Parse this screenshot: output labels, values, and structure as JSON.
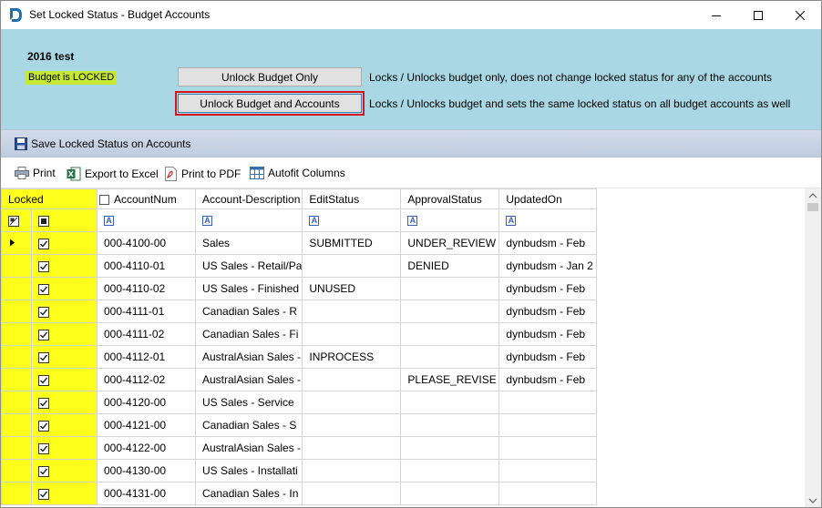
{
  "window": {
    "title": "Set Locked Status - Budget Accounts"
  },
  "panel": {
    "budget_name": "2016 test",
    "status_badge": "Budget is LOCKED",
    "status_color": "#c6e833",
    "unlock_budget_only": "Unlock Budget Only",
    "unlock_budget_only_desc": "Locks / Unlocks budget only, does not change locked status for any of the accounts",
    "unlock_budget_accounts": "Unlock Budget and Accounts",
    "unlock_budget_accounts_desc": "Locks / Unlocks budget and sets the same locked status on all budget accounts as well",
    "highlight_color": "#d9141a"
  },
  "save_band": {
    "label": "Save Locked Status on Accounts"
  },
  "toolbar": {
    "print": "Print",
    "export_excel": "Export to Excel",
    "print_pdf": "Print to PDF",
    "autofit": "Autofit Columns"
  },
  "grid": {
    "locked_column_color": "#ffff1e",
    "columns": {
      "locked": "Locked",
      "account_num": "AccountNum",
      "description": "Account-Description",
      "edit_status": "EditStatus",
      "approval_status": "ApprovalStatus",
      "updated_on": "UpdatedOn"
    },
    "filter_icon": "A",
    "rows": [
      {
        "locked": true,
        "account": "000-4100-00",
        "desc": "Sales",
        "edit": "SUBMITTED",
        "approval": "UNDER_REVIEW",
        "updated": "dynbudsm - Feb",
        "current": true
      },
      {
        "locked": true,
        "account": "000-4110-01",
        "desc": "US Sales - Retail/Pa",
        "edit": "",
        "approval": "DENIED",
        "updated": "dynbudsm - Jan 2"
      },
      {
        "locked": true,
        "account": "000-4110-02",
        "desc": "US Sales - Finished",
        "edit": "UNUSED",
        "approval": "",
        "updated": "dynbudsm - Feb"
      },
      {
        "locked": true,
        "account": "000-4111-01",
        "desc": "Canadian Sales - R",
        "edit": "",
        "approval": "",
        "updated": "dynbudsm - Feb"
      },
      {
        "locked": true,
        "account": "000-4111-02",
        "desc": "Canadian Sales - Fi",
        "edit": "",
        "approval": "",
        "updated": "dynbudsm - Feb"
      },
      {
        "locked": true,
        "account": "000-4112-01",
        "desc": "AustralAsian Sales -",
        "edit": "INPROCESS",
        "approval": "",
        "updated": "dynbudsm - Feb"
      },
      {
        "locked": true,
        "account": "000-4112-02",
        "desc": "AustralAsian Sales -",
        "edit": "",
        "approval": "PLEASE_REVISE",
        "updated": "dynbudsm - Feb"
      },
      {
        "locked": true,
        "account": "000-4120-00",
        "desc": "US Sales - Service",
        "edit": "",
        "approval": "",
        "updated": ""
      },
      {
        "locked": true,
        "account": "000-4121-00",
        "desc": "Canadian Sales - S",
        "edit": "",
        "approval": "",
        "updated": ""
      },
      {
        "locked": true,
        "account": "000-4122-00",
        "desc": "AustralAsian Sales -",
        "edit": "",
        "approval": "",
        "updated": ""
      },
      {
        "locked": true,
        "account": "000-4130-00",
        "desc": "US Sales - Installati",
        "edit": "",
        "approval": "",
        "updated": ""
      },
      {
        "locked": true,
        "account": "000-4131-00",
        "desc": "Canadian Sales - In",
        "edit": "",
        "approval": "",
        "updated": ""
      }
    ]
  }
}
